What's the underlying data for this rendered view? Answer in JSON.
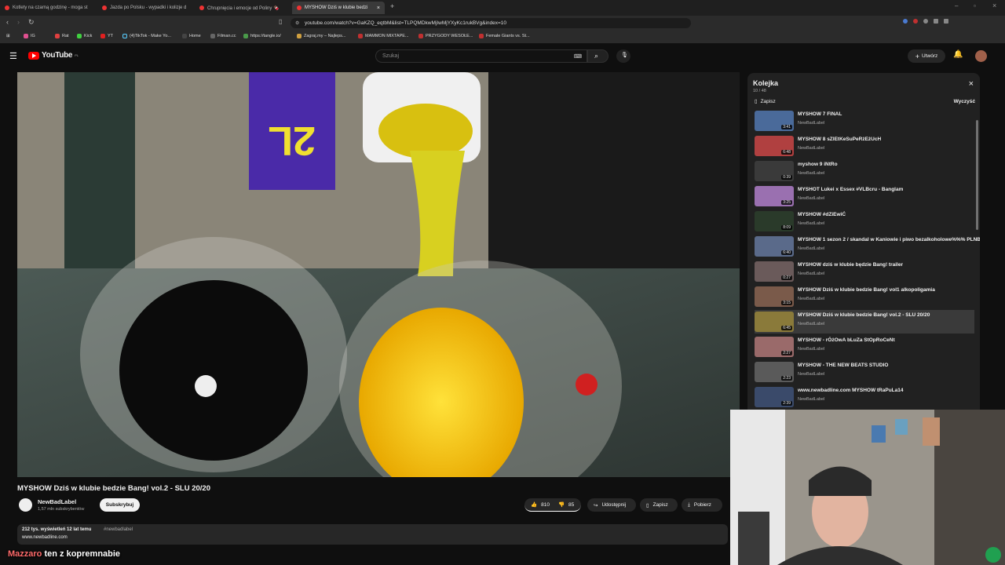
{
  "browser": {
    "tabs": [
      {
        "label": "Kotlety na czarną godzinę - moga st"
      },
      {
        "label": "Jazda po Polsku - wypadki i kolizje d"
      },
      {
        "label": "Chrupnięcia i emocje od Poliny 🍫"
      },
      {
        "label": "MYSHOW Dziś w klubie bedzi"
      }
    ],
    "url": "youtube.com/watch?v=GaKZQ_eqtbM&list=TLPQMDkwMjIwMjYXyKc1rukBVg&index=10",
    "bookmarks": [
      "IG",
      "Rat",
      "Kick",
      "YT",
      "(4)TikTok - Make Yo...",
      "Home",
      "Filman.cc",
      "https://tangle.io/",
      "Zagraj.my – Najleps...",
      "MAMMON MIXTAPE...",
      "PRZYGODY WESOŁE...",
      "Female Giants vs. St..."
    ]
  },
  "youtube": {
    "logo": "YouTube",
    "region": "PL",
    "search_placeholder": "Szukaj",
    "create_label": "Utwórz"
  },
  "video": {
    "title": "MYSHOW Dziś w klubie bedzie Bang! vol.2 - SLU 20/20",
    "channel": "NewBadLabel",
    "subscribers": "1,57 mln subskrybentów",
    "subscribe_label": "Subskrybuj",
    "likes": "810",
    "dislikes": "85",
    "share_label": "Udostępnij",
    "save_label": "Zapisz",
    "download_label": "Pobierz",
    "views_line": "212 tys. wyświetleń  12 lat temu",
    "hashtag": "#newbadlabel",
    "link": "www.newbadline.com"
  },
  "queue": {
    "title": "Kolejka",
    "position": "10 / 48",
    "save_label": "Zapisz",
    "clear_label": "Wyczyść",
    "items": [
      {
        "title": "MYSHOW 7 FINAL",
        "channel": "NewBadLabel",
        "duration": "3:41",
        "color": "#4a6a9a"
      },
      {
        "title": "MYSHOW 8 sZlEtKeSuPeRżEżUcH",
        "channel": "NewBadLabel",
        "duration": "6:48",
        "color": "#b04040"
      },
      {
        "title": "myshow 9 iNtRo",
        "channel": "NewBadLabel",
        "duration": "0:39",
        "color": "#3a3a3a"
      },
      {
        "title": "MYSHOT Lukei x Essex #VLBcru - Banglam",
        "channel": "NewBadLabel",
        "duration": "3:25",
        "color": "#9a70b0"
      },
      {
        "title": "MYSHOW #dZiEwiĆ",
        "channel": "NewBadLabel",
        "duration": "8:09",
        "color": "#2a3a2a"
      },
      {
        "title": "MYSHOW 1 sezon 2 / skandal w Kaniowie i piwo bezalkoholowe%%% PLNBeatz",
        "channel": "NewBadLabel",
        "duration": "6:40",
        "color": "#5a6a8a"
      },
      {
        "title": "MYSHOW dziś w klubie będzie Bang! trailer",
        "channel": "NewBadLabel",
        "duration": "0:27",
        "color": "#6a5a5a"
      },
      {
        "title": "MYSHOW Dziś w klubie bedzie Bang! vol1 alkopoligamia",
        "channel": "NewBadLabel",
        "duration": "3:15",
        "color": "#7a5a4a"
      },
      {
        "title": "MYSHOW Dziś w klubie bedzie Bang! vol.2 - SLU 20/20",
        "channel": "NewBadLabel",
        "duration": "6:45",
        "color": "#8a7a3a",
        "active": true
      },
      {
        "title": "MYSHOW - rÓżOwA bLuZa StOpRoCeNt",
        "channel": "NewBadLabel",
        "duration": "2:27",
        "color": "#9a6a6a"
      },
      {
        "title": "MYSHOW - THE NEW BEATS STUDIO",
        "channel": "NewBadLabel",
        "duration": "2:23",
        "color": "#5a5a5a"
      },
      {
        "title": "www.newbadline.com MYSHOW tRaPuLa14",
        "channel": "NewBadLabel",
        "duration": "2:39",
        "color": "#3a4a6a"
      }
    ]
  },
  "stream": {
    "caption_nick": "Mazzaro",
    "caption_text": "ten z kopremnabie"
  }
}
